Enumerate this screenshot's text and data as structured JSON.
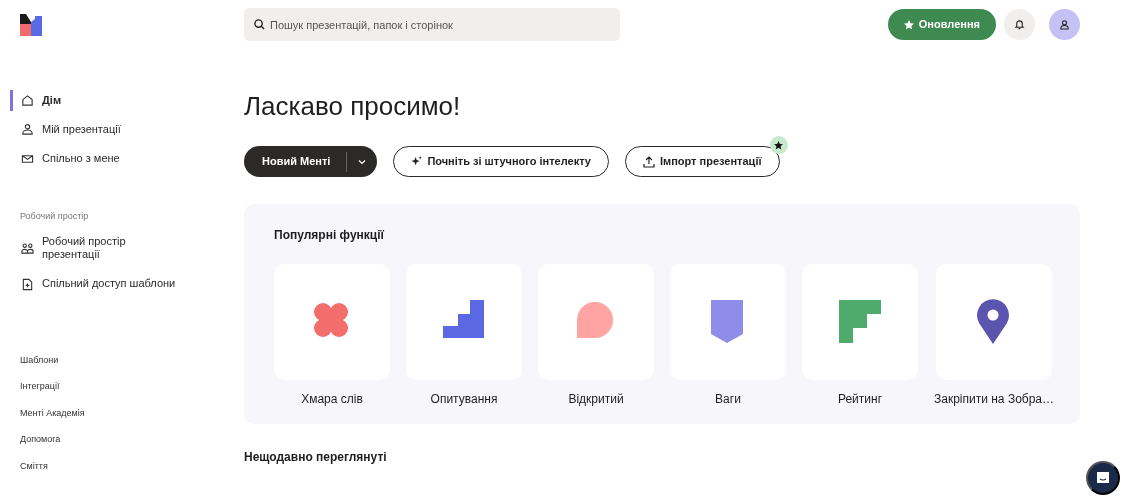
{
  "search": {
    "placeholder": "Пошук презентацій, папок і сторінок"
  },
  "upgrade_button": "Оновлення",
  "nav": [
    {
      "label": "Дім",
      "selected": true
    },
    {
      "label": "Мій презентації",
      "selected": false
    },
    {
      "label": "Спільно з мене",
      "selected": false
    }
  ],
  "workspace": {
    "heading": "Робочий простір",
    "items": [
      {
        "label": "Робочий простір презентації",
        "selected": false
      },
      {
        "label": "Спільний доступ шаблони",
        "selected": false
      }
    ]
  },
  "footer_links": [
    "Шаблони",
    "Інтеграції",
    "Менті Академія",
    "Допомога",
    "Сміття"
  ],
  "title": "Ласкаво просимо!",
  "actions": [
    {
      "label": "Новий Менті",
      "kind": "primary"
    },
    {
      "label": "Почніть зі штучного інтелекту",
      "kind": "ai"
    },
    {
      "label": "Імпорт презентації",
      "kind": "import"
    }
  ],
  "popular": {
    "heading": "Популярні функції",
    "features": [
      {
        "label": "Хмара слів",
        "kind": "wordcloud"
      },
      {
        "label": "Опитування",
        "kind": "poll"
      },
      {
        "label": "Відкритий",
        "kind": "open"
      },
      {
        "label": "Ваги",
        "kind": "scales"
      },
      {
        "label": "Рейтинг",
        "kind": "ranking"
      },
      {
        "label": "Закріпити на Зобра…",
        "kind": "pin"
      }
    ]
  },
  "recent": {
    "heading": "Нещодавно переглянуті"
  }
}
